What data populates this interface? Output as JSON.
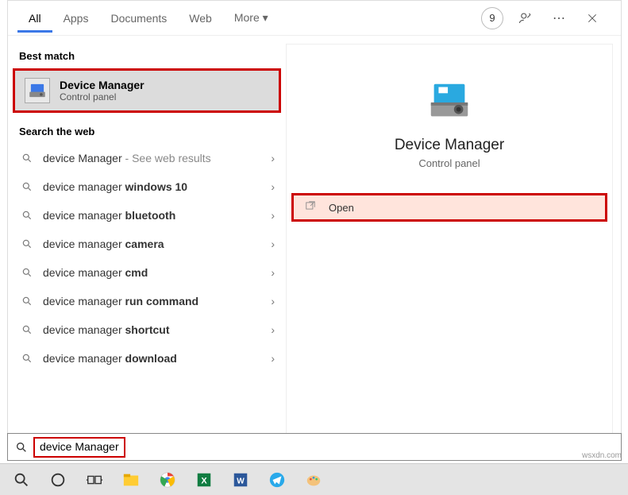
{
  "tabs": {
    "all": "All",
    "apps": "Apps",
    "documents": "Documents",
    "web": "Web",
    "more": "More"
  },
  "titlebar": {
    "badge": "9"
  },
  "sections": {
    "best_match": "Best match",
    "search_web": "Search the web"
  },
  "best_match": {
    "title": "Device Manager",
    "subtitle": "Control panel"
  },
  "suggestions": [
    {
      "prefix": "device Manager",
      "bold": "",
      "suffix": " - See web results"
    },
    {
      "prefix": "device manager ",
      "bold": "windows 10",
      "suffix": ""
    },
    {
      "prefix": "device manager ",
      "bold": "bluetooth",
      "suffix": ""
    },
    {
      "prefix": "device manager ",
      "bold": "camera",
      "suffix": ""
    },
    {
      "prefix": "device manager ",
      "bold": "cmd",
      "suffix": ""
    },
    {
      "prefix": "device manager ",
      "bold": "run command",
      "suffix": ""
    },
    {
      "prefix": "device manager ",
      "bold": "shortcut",
      "suffix": ""
    },
    {
      "prefix": "device manager ",
      "bold": "download",
      "suffix": ""
    }
  ],
  "preview": {
    "title": "Device Manager",
    "subtitle": "Control panel"
  },
  "actions": {
    "open": "Open"
  },
  "search": {
    "query": "device Manager"
  },
  "watermark": "wsxdn.com"
}
